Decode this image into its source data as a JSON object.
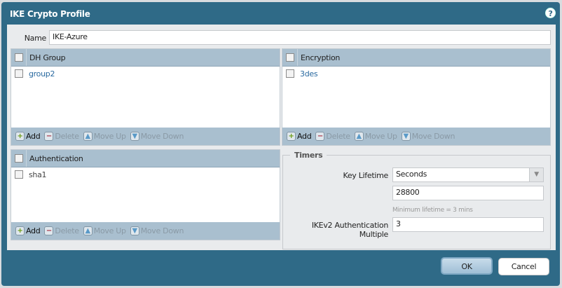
{
  "dialog": {
    "title": "IKE Crypto Profile",
    "help": "?"
  },
  "name": {
    "label": "Name",
    "value": "IKE-Azure"
  },
  "dh_group": {
    "header": "DH Group",
    "rows": [
      "group2"
    ]
  },
  "encryption": {
    "header": "Encryption",
    "rows": [
      "3des"
    ]
  },
  "authentication": {
    "header": "Authentication",
    "rows": [
      "sha1"
    ]
  },
  "toolbar": {
    "add": "Add",
    "delete": "Delete",
    "move_up": "Move Up",
    "move_down": "Move Down"
  },
  "timers": {
    "legend": "Timers",
    "key_lifetime_label": "Key Lifetime",
    "key_lifetime_unit": "Seconds",
    "key_lifetime_value": "28800",
    "hint": "Minimum lifetime = 3 mins",
    "ikev2_label": "IKEv2 Authentication Multiple",
    "ikev2_value": "3"
  },
  "buttons": {
    "ok": "OK",
    "cancel": "Cancel"
  }
}
